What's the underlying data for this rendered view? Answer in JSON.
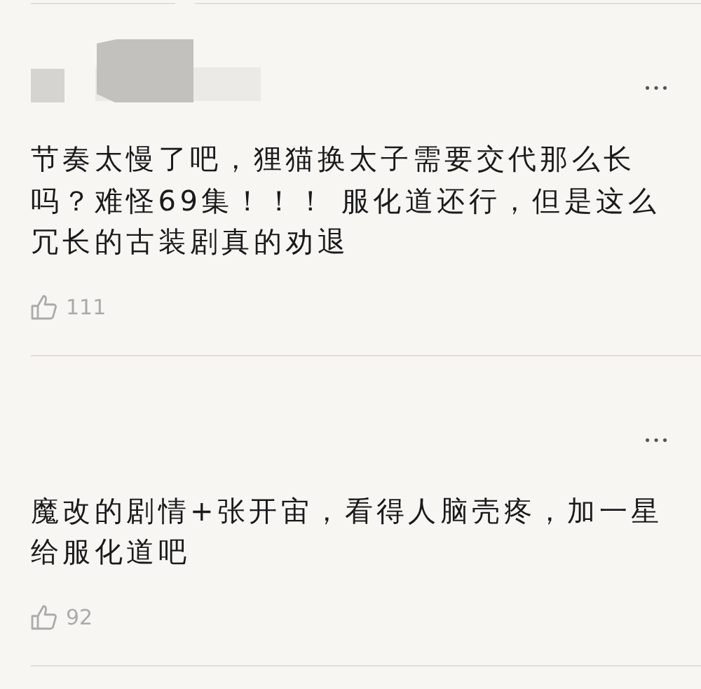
{
  "comments": [
    {
      "redacted_author": true,
      "menu": "•••",
      "text": "节奏太慢了吧，狸猫换太子需要交代那么长吗？难怪69集！！！ 服化道还行，但是这么冗长的古装剧真的劝退",
      "likes": "111"
    },
    {
      "redacted_author": false,
      "menu": "•••",
      "text": "魔改的剧情+张开宙，看得人脑壳疼，加一星给服化道吧",
      "likes": "92"
    }
  ]
}
